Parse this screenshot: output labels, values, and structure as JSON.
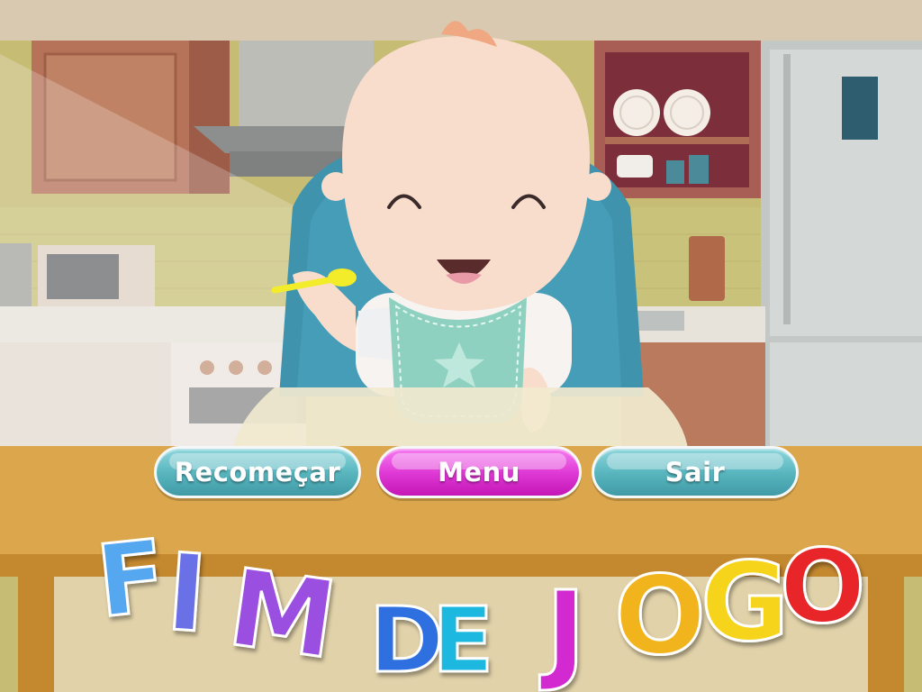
{
  "buttons": {
    "restart": "Recomeçar",
    "menu": "Menu",
    "exit": "Sair"
  },
  "title": {
    "word1": [
      "F",
      "I",
      "M"
    ],
    "word2": [
      "D",
      "E"
    ],
    "word3": [
      "J",
      "O",
      "G",
      "O"
    ]
  },
  "colors": {
    "wall": "#c8c072",
    "cabinet": "#b7775a",
    "table": "#d9a24c",
    "chair": "#3f93ad",
    "bib": "#8fd1c0",
    "button_teal": "#5ab7c0",
    "button_pink": "#e03bd6"
  },
  "icons": [
    "baby-character",
    "spoon-icon",
    "star-icon",
    "plates-icon",
    "microwave-icon",
    "fridge-icon"
  ]
}
